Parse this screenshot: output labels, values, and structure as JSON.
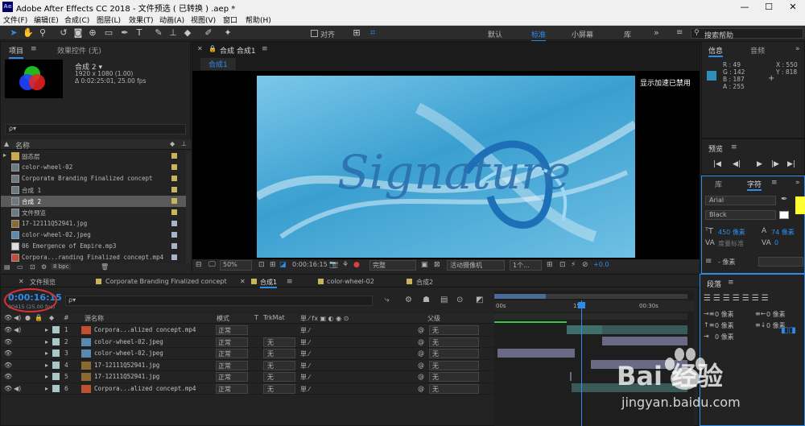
{
  "window": {
    "title": "Adobe After Effects CC 2018 - 文件预选 ( 已转换 ) .aep *",
    "logo": "Ae",
    "min": "—",
    "max": "☐",
    "close": "✕"
  },
  "menu": [
    "文件(F)",
    "编辑(E)",
    "合成(C)",
    "图层(L)",
    "效果(T)",
    "动画(A)",
    "视图(V)",
    "窗口",
    "帮助(H)"
  ],
  "toolbar": {
    "snap_label": "对齐",
    "workspaces": [
      "默认",
      "标准",
      "小屏幕",
      "库"
    ],
    "active_workspace": "标准",
    "search_placeholder": "搜索帮助",
    "more": "»"
  },
  "project": {
    "tab_project": "项目",
    "tab_effects": "效果控件 (无)",
    "comp_name": "合成 2 ▾",
    "comp_size": "1920 x 1080 (1.00)",
    "comp_duration": "Δ 0:02:25:01, 25.00 fps",
    "search_placeholder": "ρ▾",
    "col_name": "名称",
    "bpc": "8 bpc",
    "items": [
      {
        "name": "固态层",
        "color": "#c8b45a"
      },
      {
        "name": "color-wheel-02",
        "color": "#c8b45a"
      },
      {
        "name": "Corporate Branding  Finalized concept",
        "color": "#c8b45a"
      },
      {
        "name": "合成 1",
        "color": "#c8b45a"
      },
      {
        "name": "合成 2",
        "color": "#c8b45a"
      },
      {
        "name": "文件预览",
        "color": "#c8b45a"
      },
      {
        "name": "17-12111Q52941.jpg",
        "color": "#a8b4c8"
      },
      {
        "name": "color-wheel-02.jpeg",
        "color": "#a8b4c8"
      },
      {
        "name": "06 Emergence of Empire.mp3",
        "color": "#a8b4c8"
      },
      {
        "name": "Corpora...randing  Finalized concept.mp4",
        "color": "#a8b4c8"
      }
    ]
  },
  "viewer": {
    "tab_label": "合成 合成1",
    "subtab": "合成1",
    "gpu_msg": "显示加速已禁用",
    "logo_text": "Signature",
    "zoom": "50%",
    "timecode": "0:00:16:15",
    "quality": "完整",
    "camera": "活动摄像机",
    "views": "1个...",
    "exposure": "+0.0"
  },
  "info": {
    "tab_info": "信息",
    "tab_audio": "音频",
    "r": "R : 49",
    "g": "G : 142",
    "b": "B : 187",
    "a": "A : 255",
    "x": "X : 550",
    "y": "Y : 818",
    "swatch": "#318ebb"
  },
  "preview": {
    "tab": "预览",
    "controls": [
      "|◀",
      "◀|",
      "▶",
      "|▶",
      "▶|"
    ]
  },
  "character": {
    "tab_lib": "库",
    "tab_char": "字符",
    "font": "Arial",
    "style": "Black",
    "size": "450 像素",
    "leading": "74 像素",
    "kerning": "度量标准",
    "tracking": "0",
    "stroke": "- 像素"
  },
  "paragraph": {
    "tab": "段落",
    "indent_left": "0 像素",
    "indent_right": "0 像素",
    "space_before": "0 像素",
    "space_after": "0 像素",
    "indent_first": "0 像素"
  },
  "timeline": {
    "tabs": [
      "文件预览",
      "Corporate Branding  Finalized concept",
      "合成1",
      "color-wheel-02",
      "合成2"
    ],
    "active_tab": "合成1",
    "current_time": "0:00:16:15",
    "frame_info": "00415 (25.00 fps)",
    "search_placeholder": "ρ▾",
    "col_source": "源名称",
    "col_mode": "模式",
    "col_t": "T",
    "col_trkmat": "TrkMat",
    "col_parent": "父级",
    "ruler": [
      "00s",
      "15s",
      "00:30s"
    ],
    "layers": [
      {
        "num": "1",
        "name": "Corpora...alized concept.mp4",
        "mode": "正常",
        "trk": "",
        "parent": "无"
      },
      {
        "num": "2",
        "name": "color-wheel-02.jpeg",
        "mode": "正常",
        "trk": "无",
        "parent": "无"
      },
      {
        "num": "3",
        "name": "color-wheel-02.jpeg",
        "mode": "正常",
        "trk": "无",
        "parent": "无"
      },
      {
        "num": "4",
        "name": "17-12111Q52941.jpg",
        "mode": "正常",
        "trk": "无",
        "parent": "无"
      },
      {
        "num": "5",
        "name": "17-12111Q52941.jpg",
        "mode": "正常",
        "trk": "无",
        "parent": "无"
      },
      {
        "num": "6",
        "name": "Corpora...alized concept.mp4",
        "mode": "正常",
        "trk": "无",
        "parent": "无"
      }
    ]
  },
  "watermark": {
    "brand": "Bai 经验",
    "url": "jingyan.baidu.com"
  }
}
